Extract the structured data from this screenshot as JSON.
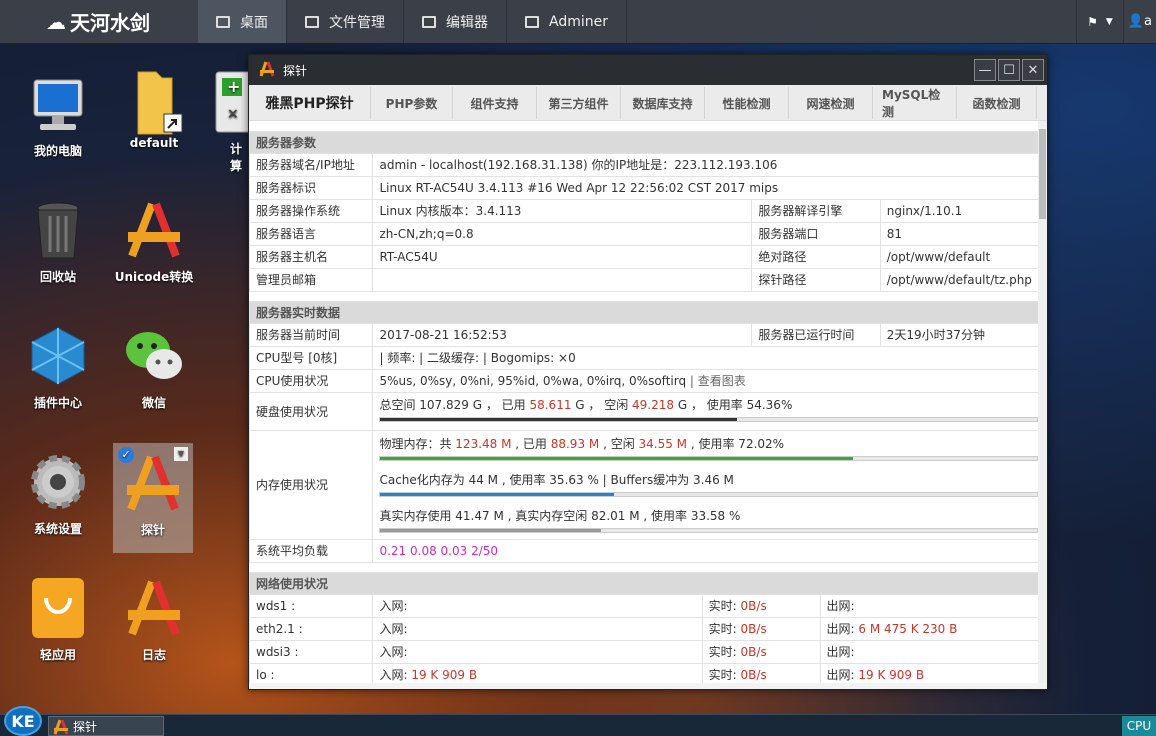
{
  "topbar": {
    "logo": "天河水剑",
    "nav": [
      "桌面",
      "文件管理",
      "编辑器",
      "Adminer"
    ],
    "user_initial": "a"
  },
  "desktop": {
    "icons": [
      "我的电脑",
      "default",
      "计算",
      "回收站",
      "Unicode转换",
      "插件中心",
      "微信",
      "系统设置",
      "探针",
      "轻应用",
      "日志"
    ]
  },
  "window": {
    "title": "探针",
    "tabs": [
      "雅黑PHP探针",
      "PHP参数",
      "组件支持",
      "第三方组件",
      "数据库支持",
      "性能检测",
      "网速检测",
      "MySQL检测",
      "函数检测"
    ],
    "server_params": {
      "header": "服务器参数",
      "domain_label": "服务器域名/IP地址",
      "domain_value": "admin - localhost(192.168.31.138)  你的IP地址是：223.112.193.106",
      "id_label": "服务器标识",
      "id_value": "Linux RT-AC54U 3.4.113 #16 Wed Apr 12 22:56:02 CST 2017 mips",
      "os_label": "服务器操作系统",
      "os_value": "Linux  内核版本：3.4.113",
      "engine_label": "服务器解译引擎",
      "engine_value": "nginx/1.10.1",
      "lang_label": "服务器语言",
      "lang_value": "zh-CN,zh;q=0.8",
      "port_label": "服务器端口",
      "port_value": "81",
      "host_label": "服务器主机名",
      "host_value": "RT-AC54U",
      "abspath_label": "绝对路径",
      "abspath_value": "/opt/www/default",
      "email_label": "管理员邮箱",
      "probe_label": "探针路径",
      "probe_value": "/opt/www/default/tz.php"
    },
    "realtime": {
      "header": "服务器实时数据",
      "time_label": "服务器当前时间",
      "time_value": "2017-08-21 16:52:53",
      "uptime_label": "服务器已运行时间",
      "uptime_value": "2天19小时37分钟",
      "cpu_label": "CPU型号 [0核]",
      "cpu_value": "| 频率: | 二级缓存: | Bogomips: ×0",
      "cpuuse_label": "CPU使用状况",
      "cpuuse_value": "5%us, 0%sy, 0%ni, 95%id, 0%wa, 0%irq, 0%softirq",
      "cpuuse_link": "| 查看图表",
      "disk_label": "硬盘使用状况",
      "disk_prefix": "总空间 107.829 G ， 已用 ",
      "disk_used": "58.611",
      "disk_mid": " G ， 空闲 ",
      "disk_free": "49.218",
      "disk_suffix": " G ， 使用率 54.36%",
      "disk_pct": 54.36,
      "mem_label": "内存使用状况",
      "mem_prefix": "物理内存：共 ",
      "mem_total": "123.48 M",
      "mem_used_pre": " , 已用 ",
      "mem_used": "88.93 M",
      "mem_free_pre": " , 空闲 ",
      "mem_free": "34.55 M",
      "mem_suffix": " , 使用率 72.02%",
      "mem_pct": 72.02,
      "cache_text": "Cache化内存为 44 M , 使用率 35.63 % | Buffers缓冲为 3.46 M",
      "cache_pct": 35.63,
      "real_text": "真实内存使用 41.47 M , 真实内存空闲 82.01 M , 使用率 33.58 %",
      "real_pct": 33.58,
      "load_label": "系统平均负载",
      "load_value": "0.21 0.08 0.03 2/50"
    },
    "network": {
      "header": "网络使用状况",
      "in_label": "入网:",
      "rt_label": "实时:",
      "out_label": "出网:",
      "rows": [
        {
          "name": "wds1 :",
          "in": "",
          "rt": "0B/s",
          "out": ""
        },
        {
          "name": "eth2.1 :",
          "in": "",
          "rt": "0B/s",
          "out": "6 M 475 K 230 B"
        },
        {
          "name": "wdsi3 :",
          "in": "",
          "rt": "0B/s",
          "out": ""
        },
        {
          "name": "lo :",
          "in": "19 K 909 B",
          "rt": "0B/s",
          "out": "19 K 909 B"
        }
      ]
    }
  },
  "taskbar": {
    "start": "KE",
    "item": "探针",
    "cpu": "CPU"
  }
}
